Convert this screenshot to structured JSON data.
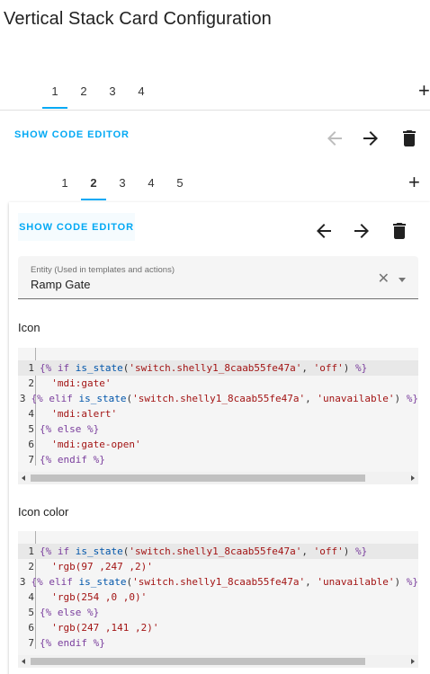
{
  "page": {
    "title": "Vertical Stack Card Configuration"
  },
  "outer": {
    "tabs": [
      "1",
      "2",
      "3",
      "4"
    ],
    "active_tab": "1",
    "add_label": "+",
    "code_editor_label": "SHOW CODE EDITOR"
  },
  "inner": {
    "tabs": [
      "1",
      "2",
      "3",
      "4",
      "5"
    ],
    "active_tab": "2",
    "add_label": "+",
    "code_editor_label": "SHOW CODE EDITOR",
    "entity": {
      "label": "Entity (Used in templates and actions)",
      "value": "Ramp Gate",
      "clear_label": "✕"
    },
    "icon_section": {
      "label": "Icon",
      "lines": [
        "{% if is_state('switch.shelly1_8caab55fe47a', 'off') %}",
        "  'mdi:gate'",
        "{% elif is_state('switch.shelly1_8caab55fe47a', 'unavailable') %}",
        "  'mdi:alert'",
        "{% else %}",
        "  'mdi:gate-open'",
        "{% endif %}"
      ]
    },
    "icon_color_section": {
      "label": "Icon color",
      "lines": [
        "{% if is_state('switch.shelly1_8caab55fe47a', 'off') %}",
        "  'rgb(97 ,247 ,2)'",
        "{% elif is_state('switch.shelly1_8caab55fe47a', 'unavailable') %}",
        "  'rgb(254 ,0 ,0)'",
        "{% else %}",
        "  'rgb(247 ,141 ,2)'",
        "{% endif %}"
      ]
    }
  },
  "icons": {
    "back": "arrow-left-icon",
    "forward": "arrow-right-icon",
    "delete": "trash-icon",
    "clear": "close-icon",
    "dropdown": "chevron-down-icon"
  },
  "colors": {
    "accent": "#03a9f4",
    "disabled": "#bdbdbd",
    "text": "#212121"
  }
}
